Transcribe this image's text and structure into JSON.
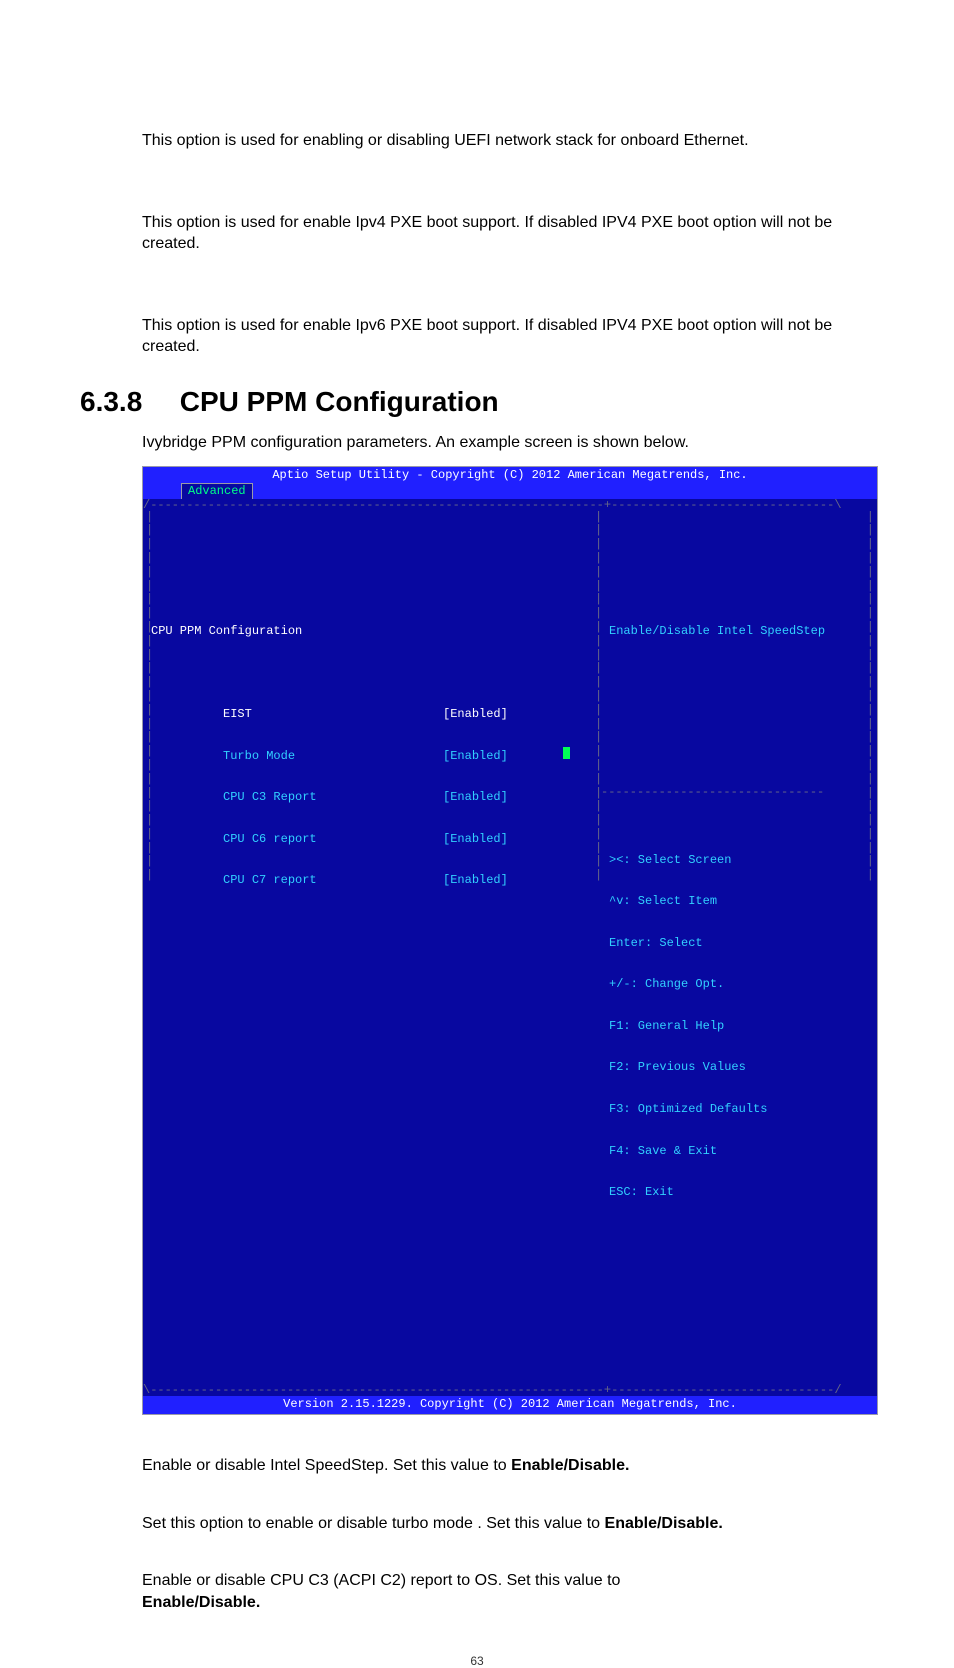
{
  "para1": "This option is used for enabling or disabling UEFI network stack for onboard Ethernet.",
  "para2": "This option is used for enable Ipv4 PXE boot support. If disabled IPV4 PXE boot option will not be created.",
  "para3": "This option is used for enable Ipv6 PXE boot support. If disabled IPV4 PXE boot option will not be created.",
  "section": {
    "number": "6.3.8",
    "title": "CPU PPM Configuration"
  },
  "section_intro": "Ivybridge PPM configuration parameters. An example screen is shown below.",
  "bios": {
    "title": "Aptio Setup Utility - Copyright (C) 2012 American Megatrends, Inc.",
    "tab": "Advanced",
    "cfg_title": "CPU PPM Configuration",
    "desc": "Enable/Disable Intel SpeedStep",
    "items": [
      {
        "label": "EIST",
        "value": "[Enabled]",
        "selected": true
      },
      {
        "label": "Turbo Mode",
        "value": "[Enabled]",
        "selected": false
      },
      {
        "label": "CPU C3 Report",
        "value": "[Enabled]",
        "selected": false
      },
      {
        "label": "CPU C6 report",
        "value": "[Enabled]",
        "selected": false
      },
      {
        "label": "CPU C7 report",
        "value": "[Enabled]",
        "selected": false
      }
    ],
    "help": [
      "><: Select Screen",
      "^v: Select Item",
      "Enter: Select",
      "+/-: Change Opt.",
      "F1: General Help",
      "F2: Previous Values",
      "F3: Optimized Defaults",
      "F4: Save & Exit",
      "ESC: Exit"
    ],
    "footer": "Version 2.15.1229. Copyright (C) 2012 American Megatrends, Inc."
  },
  "post": {
    "eist": {
      "pre": "Enable or disable Intel SpeedStep. Set this value to ",
      "bold": "Enable/Disable."
    },
    "turbo": {
      "pre": "Set this option to enable or disable turbo mode . Set this value to ",
      "bold": "Enable/Disable."
    },
    "c3": {
      "pre": "Enable or disable CPU C3 (ACPI C2) report to OS. Set this value to ",
      "bold": "Enable/Disable."
    }
  },
  "pagenum": "63"
}
